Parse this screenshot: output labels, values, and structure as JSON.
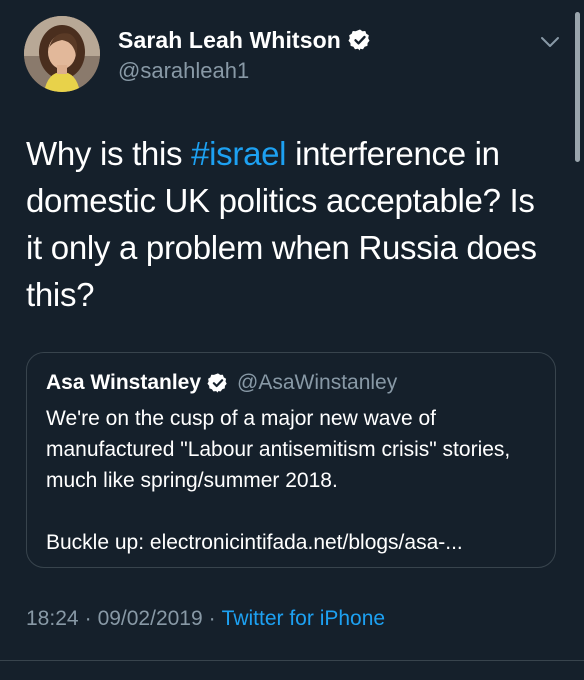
{
  "author": {
    "display_name": "Sarah Leah Whitson",
    "handle": "@sarahleah1",
    "verified_icon": "verified-badge-icon",
    "avatar": "profile-photo"
  },
  "tweet": {
    "text_before": "Why is this ",
    "hashtag": "#israel",
    "text_after": " interference in domestic UK politics acceptable? Is it only a problem when Russia does this?"
  },
  "quoted_tweet": {
    "display_name": "Asa Winstanley",
    "handle": "@AsaWinstanley",
    "text": "We're on the cusp of a major new wave of manufactured \"Labour antisemitism crisis\" stories, much like spring/summer 2018.\n\nBuckle up: electronicintifada.net/blogs/asa-..."
  },
  "meta": {
    "time": "18:24",
    "separator": "·",
    "date": "09/02/2019",
    "source": "Twitter for iPhone"
  },
  "colors": {
    "background": "#15202b",
    "accent": "#1da1f2",
    "secondary_text": "#8899a6",
    "border": "#38444d"
  }
}
